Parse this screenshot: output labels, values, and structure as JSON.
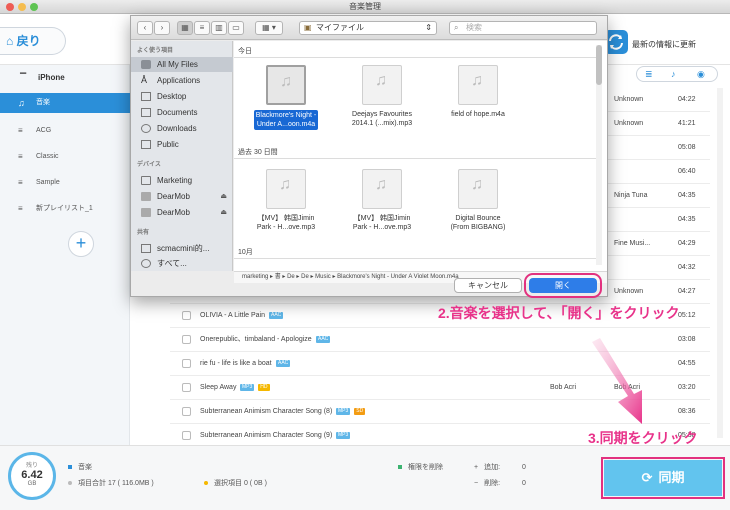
{
  "window": {
    "title": "音楽管理"
  },
  "header": {
    "back_label": "戻り",
    "refresh_label": "最新の情報に更新"
  },
  "sidebar": {
    "device": "iPhone",
    "items": [
      {
        "label": "音楽",
        "active": true
      },
      {
        "label": "ACG"
      },
      {
        "label": "Classic"
      },
      {
        "label": "Sample"
      },
      {
        "label": "新プレイリスト_1"
      }
    ],
    "add_label": "+"
  },
  "tracks": [
    {
      "title": "",
      "tags": [],
      "artist": "",
      "album": "Unknown",
      "duration": "04:22"
    },
    {
      "title": "",
      "tags": [],
      "artist": "",
      "album": "Unknown",
      "duration": "41:21"
    },
    {
      "title": "",
      "tags": [],
      "artist": "",
      "album": "",
      "duration": "05:08"
    },
    {
      "title": "",
      "tags": [],
      "artist": "",
      "album": "",
      "duration": "06:40"
    },
    {
      "title": "",
      "tags": [],
      "artist": "",
      "album": "Ninja Tuna",
      "duration": "04:35"
    },
    {
      "title": "",
      "tags": [],
      "artist": "",
      "album": "",
      "duration": "04:35"
    },
    {
      "title": "",
      "tags": [],
      "artist": "",
      "album": "Fine Musi...",
      "duration": "04:29"
    },
    {
      "title": "",
      "tags": [],
      "artist": "",
      "album": "",
      "duration": "04:32"
    },
    {
      "title": "",
      "tags": [],
      "artist": "",
      "album": "Unknown",
      "duration": "04:27"
    },
    {
      "title": "OLIVIA - A Little Pain",
      "tags": [
        "AAC"
      ],
      "artist": "",
      "album": "",
      "duration": "05:12"
    },
    {
      "title": "Onerepublic、timbaland - Apologize",
      "tags": [
        "AAC"
      ],
      "artist": "",
      "album": "",
      "duration": "03:08"
    },
    {
      "title": "rie fu - life is like a boat",
      "tags": [
        "AAC"
      ],
      "artist": "",
      "album": "",
      "duration": "04:55"
    },
    {
      "title": "Sleep Away",
      "tags": [
        "HD",
        "MP3"
      ],
      "artist": "Bob Acri",
      "album": "Bob Acri",
      "duration": "03:20"
    },
    {
      "title": "Subterranean Animism Character Song (8)",
      "tags": [
        "SD",
        "MP3"
      ],
      "artist": "",
      "album": "",
      "duration": "08:36"
    },
    {
      "title": "Subterranean Animism Character Song (9)",
      "tags": [
        "MP3"
      ],
      "artist": "",
      "album": "",
      "duration": "05:38"
    }
  ],
  "footer": {
    "gauge": {
      "label": "残り",
      "value": "6.42",
      "unit": "GB"
    },
    "music_label": "音楽",
    "total_label": "項目合計 17 ( 116.0MB )",
    "selected_label": "選択項目 0 ( 0B )",
    "delete_label": "権限を削除",
    "add_label": "追加:",
    "add_count": "0",
    "remove_label": "削除:",
    "remove_count": "0",
    "sync_label": "同期"
  },
  "dialog": {
    "location": "マイファイル",
    "search_placeholder": "検索",
    "sections": {
      "favorites": "よく使う項目",
      "devices": "デバイス",
      "shared": "共有"
    },
    "favorites": [
      "All My Files",
      "Applications",
      "Desktop",
      "Documents",
      "Downloads",
      "Public"
    ],
    "devices": [
      "Marketing",
      "DearMob",
      "DearMob"
    ],
    "shared": [
      "scmacmini的...",
      "すべて..."
    ],
    "groups": [
      "今日",
      "過去 30 日間",
      "10月"
    ],
    "files_today": [
      {
        "name1": "Blackmore's Night -",
        "name2": "Under A...oon.m4a",
        "selected": true
      },
      {
        "name1": "Deejays Favourites",
        "name2": "2014.1 (...mix).mp3"
      },
      {
        "name1": "field of hope.m4a",
        "name2": ""
      }
    ],
    "files_30": [
      {
        "name1": "【MV】 韩国Jimin",
        "name2": "Park - H...ove.mp3"
      },
      {
        "name1": "【MV】 韩国Jimin",
        "name2": "Park - H...ove.mp3"
      },
      {
        "name1": "Digital Bounce",
        "name2": "(From BIGBANG)"
      }
    ],
    "path": [
      "marketing",
      "書",
      "De",
      "De",
      "Music",
      "Blackmore's Night - Under A Violet Moon.m4a"
    ],
    "cancel_label": "キャンセル",
    "open_label": "開く"
  },
  "annotations": {
    "step2": "2.音楽を選択して、「開く」をクリック",
    "step3": "3.同期をクリック"
  },
  "colors": {
    "accent": "#2b8fd9",
    "annotation": "#e8338a",
    "sync": "#62c4ee",
    "selection": "#1868d4"
  }
}
